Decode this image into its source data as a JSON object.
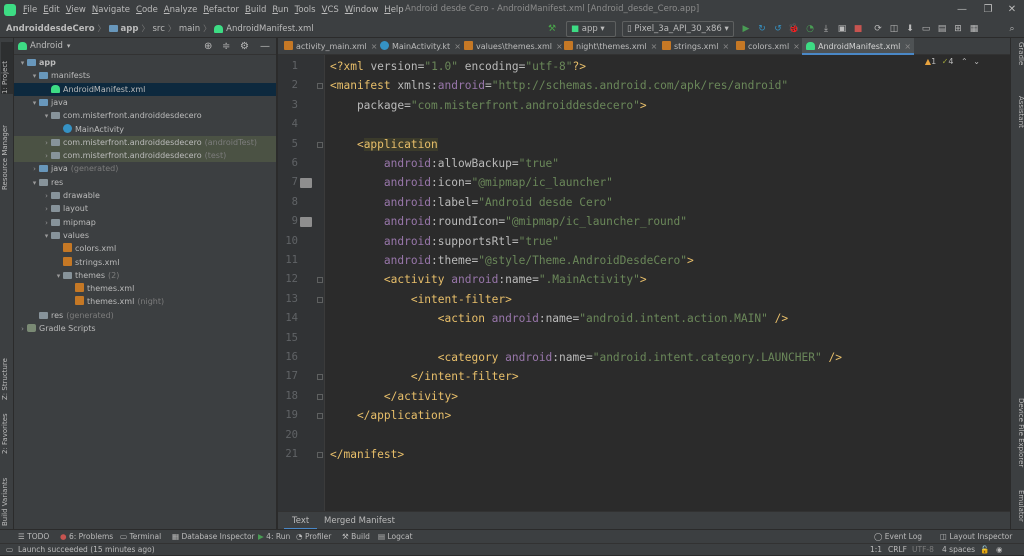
{
  "menubar": {
    "items": [
      "File",
      "Edit",
      "View",
      "Navigate",
      "Code",
      "Analyze",
      "Refactor",
      "Build",
      "Run",
      "Tools",
      "VCS",
      "Window",
      "Help"
    ],
    "window_title": "Android desde Cero - AndroidManifest.xml [Android_desde_Cero.app]"
  },
  "navbar": {
    "crumbs": [
      "AndroiddesdeCero",
      "app",
      "src",
      "main",
      "AndroidManifest.xml"
    ],
    "run_config": "app",
    "device": "Pixel_3a_API_30_x86"
  },
  "left_tools": [
    "1: Project",
    "Resource Manager",
    "Z: Structure",
    "2: Favorites",
    "Build Variants"
  ],
  "right_tools": [
    "Gradle",
    "Assistant",
    "Device File Explorer",
    "Emulator"
  ],
  "project": {
    "view": "Android",
    "tree": [
      {
        "label": "app",
        "suffix": "",
        "indent": 0,
        "arrow": "▾",
        "icon": "folder-blue",
        "bold": true
      },
      {
        "label": "manifests",
        "suffix": "",
        "indent": 1,
        "arrow": "▾",
        "icon": "folder-blue"
      },
      {
        "label": "AndroidManifest.xml",
        "suffix": "",
        "indent": 2,
        "arrow": "",
        "icon": "android",
        "state": "selected"
      },
      {
        "label": "java",
        "suffix": "",
        "indent": 1,
        "arrow": "▾",
        "icon": "folder-blue"
      },
      {
        "label": "com.misterfront.androiddesdecero",
        "suffix": "",
        "indent": 2,
        "arrow": "▾",
        "icon": "folder"
      },
      {
        "label": "MainActivity",
        "suffix": "",
        "indent": 3,
        "arrow": "",
        "icon": "class"
      },
      {
        "label": "com.misterfront.androiddesdecero",
        "suffix": "(androidTest)",
        "indent": 2,
        "arrow": "›",
        "icon": "folder",
        "state": "hl"
      },
      {
        "label": "com.misterfront.androiddesdecero",
        "suffix": "(test)",
        "indent": 2,
        "arrow": "›",
        "icon": "folder",
        "state": "hl"
      },
      {
        "label": "java",
        "suffix": "(generated)",
        "indent": 1,
        "arrow": "›",
        "icon": "folder-blue"
      },
      {
        "label": "res",
        "suffix": "",
        "indent": 1,
        "arrow": "▾",
        "icon": "folder"
      },
      {
        "label": "drawable",
        "suffix": "",
        "indent": 2,
        "arrow": "›",
        "icon": "folder"
      },
      {
        "label": "layout",
        "suffix": "",
        "indent": 2,
        "arrow": "›",
        "icon": "folder"
      },
      {
        "label": "mipmap",
        "suffix": "",
        "indent": 2,
        "arrow": "›",
        "icon": "folder"
      },
      {
        "label": "values",
        "suffix": "",
        "indent": 2,
        "arrow": "▾",
        "icon": "folder"
      },
      {
        "label": "colors.xml",
        "suffix": "",
        "indent": 3,
        "arrow": "",
        "icon": "xml"
      },
      {
        "label": "strings.xml",
        "suffix": "",
        "indent": 3,
        "arrow": "",
        "icon": "xml"
      },
      {
        "label": "themes",
        "suffix": "(2)",
        "indent": 3,
        "arrow": "▾",
        "icon": "folder"
      },
      {
        "label": "themes.xml",
        "suffix": "",
        "indent": 4,
        "arrow": "",
        "icon": "xml"
      },
      {
        "label": "themes.xml",
        "suffix": "(night)",
        "indent": 4,
        "arrow": "",
        "icon": "xml"
      },
      {
        "label": "res",
        "suffix": "(generated)",
        "indent": 1,
        "arrow": "",
        "icon": "folder"
      },
      {
        "label": "Gradle Scripts",
        "suffix": "",
        "indent": 0,
        "arrow": "›",
        "icon": "gradle"
      }
    ]
  },
  "tabs": [
    {
      "label": "activity_main.xml",
      "icon": "xml"
    },
    {
      "label": "MainActivity.kt",
      "icon": "class"
    },
    {
      "label": "values\\themes.xml",
      "icon": "xml"
    },
    {
      "label": "night\\themes.xml",
      "icon": "xml"
    },
    {
      "label": "strings.xml",
      "icon": "xml"
    },
    {
      "label": "colors.xml",
      "icon": "xml"
    },
    {
      "label": "AndroidManifest.xml",
      "icon": "android",
      "active": true
    }
  ],
  "inspections": {
    "warnings": "1",
    "weak_warnings": "4"
  },
  "code": [
    [
      [
        "punct",
        "<?"
      ],
      [
        "tag",
        "xml"
      ],
      [
        "attr",
        " version="
      ],
      [
        "val",
        "\"1.0\""
      ],
      [
        "attr",
        " encoding="
      ],
      [
        "val",
        "\"utf-8\""
      ],
      [
        "punct",
        "?>"
      ]
    ],
    [
      [
        "punct",
        "<"
      ],
      [
        "tag",
        "manifest"
      ],
      [
        "attr",
        " xmlns:"
      ],
      [
        "ns",
        "android"
      ],
      [
        "attr",
        "="
      ],
      [
        "val",
        "\"http://schemas.android.com/apk/res/android\""
      ]
    ],
    [
      [
        "attr",
        "    package="
      ],
      [
        "val",
        "\"com.misterfront.androiddesdecero\""
      ],
      [
        "punct",
        ">"
      ]
    ],
    [],
    [
      [
        "punct",
        "    <"
      ],
      [
        "tag",
        "application"
      ]
    ],
    [
      [
        "ns",
        "        android"
      ],
      [
        "attr",
        ":allowBackup="
      ],
      [
        "val",
        "\"true\""
      ]
    ],
    [
      [
        "ns",
        "        android"
      ],
      [
        "attr",
        ":icon="
      ],
      [
        "val",
        "\"@mipmap/ic_launcher\""
      ]
    ],
    [
      [
        "ns",
        "        android"
      ],
      [
        "attr",
        ":label="
      ],
      [
        "val",
        "\"Android desde Cero\""
      ]
    ],
    [
      [
        "ns",
        "        android"
      ],
      [
        "attr",
        ":roundIcon="
      ],
      [
        "val",
        "\"@mipmap/ic_launcher_round\""
      ]
    ],
    [
      [
        "ns",
        "        android"
      ],
      [
        "attr",
        ":supportsRtl="
      ],
      [
        "val",
        "\"true\""
      ]
    ],
    [
      [
        "ns",
        "        android"
      ],
      [
        "attr",
        ":theme="
      ],
      [
        "val",
        "\"@style/Theme.AndroidDesdeCero\""
      ],
      [
        "punct",
        ">"
      ]
    ],
    [
      [
        "punct",
        "        <"
      ],
      [
        "tag",
        "activity"
      ],
      [
        "ns",
        " android"
      ],
      [
        "attr",
        ":name="
      ],
      [
        "val",
        "\".MainActivity\""
      ],
      [
        "punct",
        ">"
      ]
    ],
    [
      [
        "punct",
        "            <"
      ],
      [
        "tag",
        "intent-filter"
      ],
      [
        "punct",
        ">"
      ]
    ],
    [
      [
        "punct",
        "                <"
      ],
      [
        "tag",
        "action"
      ],
      [
        "ns",
        " android"
      ],
      [
        "attr",
        ":name="
      ],
      [
        "val",
        "\"android.intent.action.MAIN\""
      ],
      [
        "punct",
        " />"
      ]
    ],
    [],
    [
      [
        "punct",
        "                <"
      ],
      [
        "tag",
        "category"
      ],
      [
        "ns",
        " android"
      ],
      [
        "attr",
        ":name="
      ],
      [
        "val",
        "\"android.intent.category.LAUNCHER\""
      ],
      [
        "punct",
        " />"
      ]
    ],
    [
      [
        "punct",
        "            </"
      ],
      [
        "tag",
        "intent-filter"
      ],
      [
        "punct",
        ">"
      ]
    ],
    [
      [
        "punct",
        "        </"
      ],
      [
        "tag",
        "activity"
      ],
      [
        "punct",
        ">"
      ]
    ],
    [
      [
        "punct",
        "    </"
      ],
      [
        "tag",
        "application"
      ],
      [
        "punct",
        ">"
      ]
    ],
    [],
    [
      [
        "punct",
        "</"
      ],
      [
        "tag",
        "manifest"
      ],
      [
        "punct",
        ">"
      ]
    ]
  ],
  "editor_bottom_tabs": [
    "Text",
    "Merged Manifest"
  ],
  "tool_windows": [
    "TODO",
    "6: Problems",
    "Terminal",
    "Database Inspector",
    "4: Run",
    "Profiler",
    "Build",
    "Logcat"
  ],
  "tool_windows_right": [
    "Event Log",
    "Layout Inspector"
  ],
  "status": {
    "message": "Launch succeeded (15 minutes ago)",
    "position": "1:1",
    "line_sep": "CRLF",
    "encoding": "UTF-8",
    "indent": "4 spaces"
  },
  "colors": {
    "accent": "#4a88c7",
    "tag": "#e8bf6a",
    "value": "#6a8759",
    "namespace": "#9876aa"
  }
}
